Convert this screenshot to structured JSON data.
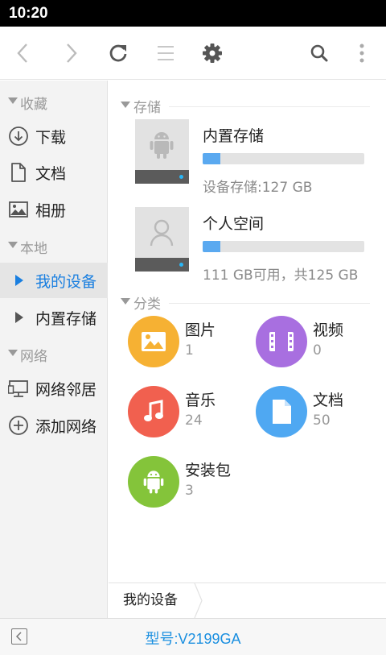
{
  "status_bar": {
    "time": "10:20"
  },
  "toolbar": {
    "icons": [
      "back-icon",
      "forward-icon",
      "refresh-icon",
      "list-view-icon",
      "settings-icon",
      "search-icon",
      "more-options-icon"
    ]
  },
  "sidebar": {
    "sections": [
      {
        "title": "收藏",
        "items": [
          {
            "label": "下载",
            "icon": "download-icon"
          },
          {
            "label": "文档",
            "icon": "document-icon"
          },
          {
            "label": "相册",
            "icon": "photo-album-icon"
          }
        ]
      },
      {
        "title": "本地",
        "items": [
          {
            "label": "我的设备",
            "icon": "expand-arrow-icon",
            "active": true
          },
          {
            "label": "内置存储",
            "icon": "expand-arrow-icon"
          }
        ]
      },
      {
        "title": "网络",
        "items": [
          {
            "label": "网络邻居",
            "icon": "network-neighborhood-icon"
          },
          {
            "label": "添加网络",
            "icon": "add-network-icon"
          }
        ]
      }
    ]
  },
  "main": {
    "storage_section": "存储",
    "storage": [
      {
        "name": "内置存储",
        "detail": "设备存储:127 GB",
        "usage_fraction": 0.11,
        "icon": "android-icon"
      },
      {
        "name": "个人空间",
        "detail": "111 GB可用，共125 GB",
        "usage_fraction": 0.11,
        "icon": "person-icon"
      }
    ],
    "category_section": "分类",
    "categories": [
      {
        "name": "图片",
        "count": "1",
        "color": "#f6b133",
        "icon": "image-icon"
      },
      {
        "name": "视频",
        "count": "0",
        "color": "#a86fe0",
        "icon": "video-icon"
      },
      {
        "name": "音乐",
        "count": "24",
        "color": "#f1604f",
        "icon": "music-icon"
      },
      {
        "name": "文档",
        "count": "50",
        "color": "#4fa8f2",
        "icon": "document-icon"
      },
      {
        "name": "安装包",
        "count": "3",
        "color": "#84c43a",
        "icon": "android-icon"
      }
    ]
  },
  "breadcrumb": {
    "current": "我的设备"
  },
  "footer": {
    "model": "型号:V2199GA"
  },
  "colors": {
    "accent": "#1a7fe0",
    "storage_bar": "#5aa9f0",
    "sidebar_bg": "#f3f3f3"
  }
}
